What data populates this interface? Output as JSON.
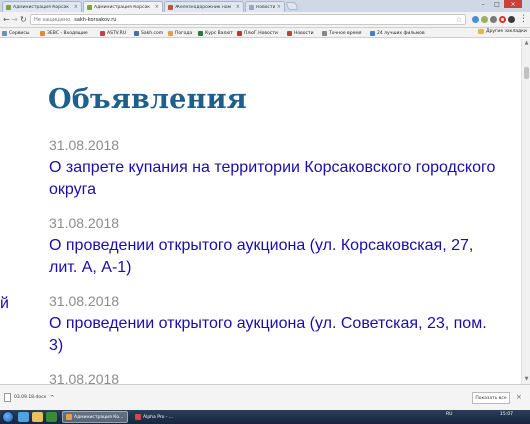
{
  "browser": {
    "tabs": [
      {
        "title": "Администрация Корсак",
        "color": "#7aa339"
      },
      {
        "title": "Администрация Корсак",
        "color": "#7aa339"
      },
      {
        "title": "Железнодорожник нам",
        "color": "#d24a3a"
      },
      {
        "title": "Новости",
        "color": "#9aa6b5"
      }
    ],
    "security_label": "Не защищено",
    "url": "sakh-korsakov.ru",
    "bookmarks": [
      {
        "label": "Сервисы",
        "color": "#6f8fb8"
      },
      {
        "label": "ЗЕВС - Входящие",
        "color": "#e08a2a"
      },
      {
        "label": "ASTV.RU",
        "color": "#c94040"
      },
      {
        "label": "Sakh.com",
        "color": "#4070b0"
      },
      {
        "label": "Погода",
        "color": "#e6a23a"
      },
      {
        "label": "Курс Валют",
        "color": "#2a7a3a"
      },
      {
        "label": "ПлюГ.Новости",
        "color": "#b8392e"
      },
      {
        "label": "Новости",
        "color": "#c83c3c"
      },
      {
        "label": "Точное время",
        "color": "#888888"
      },
      {
        "label": "24 лучших фильмов",
        "color": "#3f7fd0"
      }
    ],
    "bookmarks_other": "Другие закладки"
  },
  "page": {
    "title": "Объявления",
    "edge_char": "й",
    "announcements": [
      {
        "date": "31.08.2018",
        "title": "О запрете купания на территории Корсаковского городского округа"
      },
      {
        "date": "31.08.2018",
        "title": "О проведении открытого аукциона (ул. Корсаковская, 27, лит. А, А-1)"
      },
      {
        "date": "31.08.2018",
        "title": "О проведении открытого аукциона (ул. Советская, 23, пом. 3)"
      },
      {
        "date": "31.08.2018",
        "title": ""
      }
    ]
  },
  "downloads": {
    "file": "03.09.18.docx",
    "show_all": "Показать все"
  },
  "taskbar": {
    "tasks": [
      {
        "label": "Администрация Ко...",
        "color": "#e6a23a"
      },
      {
        "label": "Alpha Pro - ...",
        "color": "#d04a4a"
      }
    ],
    "lang": "RU",
    "time": "15:07"
  },
  "colors": {
    "title": "#1f5f8c",
    "link": "#1a0dab",
    "date": "#8c8c8c"
  }
}
